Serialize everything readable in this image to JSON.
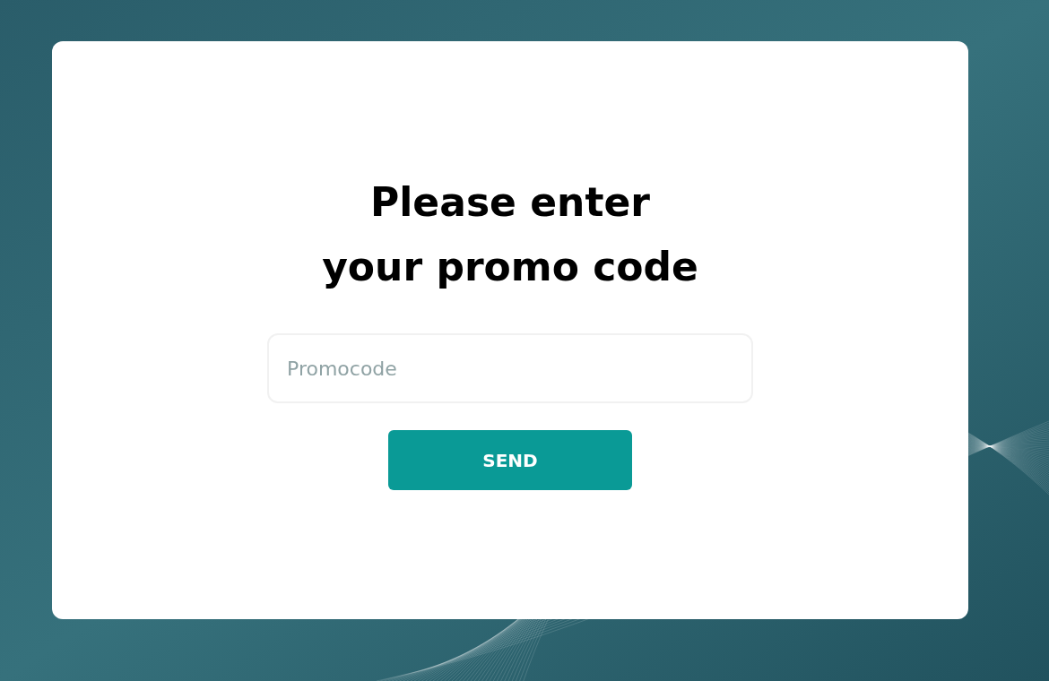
{
  "heading": "Please enter\nyour promo code",
  "promo_field": {
    "placeholder": "Promocode"
  },
  "send_button": {
    "label": "SEND"
  }
}
